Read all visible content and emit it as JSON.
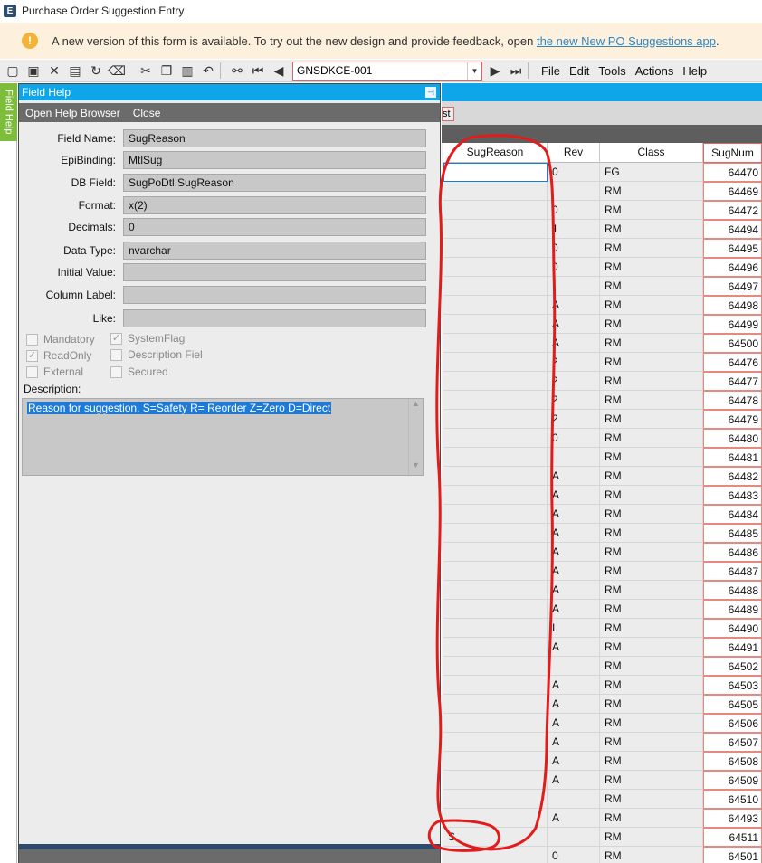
{
  "window": {
    "title": "Purchase Order Suggestion Entry"
  },
  "banner": {
    "text": "A new version of this form is available. To try out the new design and provide feedback, open ",
    "link": "the new New PO Suggestions app",
    "suffix": "."
  },
  "toolbar": {
    "combo_value": "GNSDKCE-001",
    "menus": [
      "File",
      "Edit",
      "Tools",
      "Actions",
      "Help"
    ]
  },
  "side_tab": "Field Help",
  "field_help": {
    "title": "Field Help",
    "open_browser": "Open Help Browser",
    "close": "Close",
    "fields": [
      {
        "label": "Field Name:",
        "value": "SugReason"
      },
      {
        "label": "EpiBinding:",
        "value": "MtlSug"
      },
      {
        "label": "DB Field:",
        "value": "SugPoDtl.SugReason"
      },
      {
        "label": "Format:",
        "value": "x(2)"
      },
      {
        "label": "Decimals:",
        "value": "0"
      },
      {
        "label": "Data Type:",
        "value": "nvarchar"
      },
      {
        "label": "Initial Value:",
        "value": ""
      },
      {
        "label": "Column Label:",
        "value": ""
      },
      {
        "label": "Like:",
        "value": ""
      }
    ],
    "checks": {
      "mandatory": "Mandatory",
      "system_flag": "SystemFlag",
      "read_only": "ReadOnly",
      "description_field": "Description Fiel",
      "external": "External",
      "secured": "Secured"
    },
    "description_label": "Description:",
    "description": "Reason for suggestion. S=Safety  R= Reorder Z=Zero D=Direct"
  },
  "right_tab_fragment": "st",
  "grid": {
    "columns": [
      "SugReason",
      "Rev",
      "Class",
      "SugNum"
    ],
    "rows": [
      [
        "",
        "0",
        "FG",
        "64470"
      ],
      [
        "",
        "",
        "RM",
        "64469"
      ],
      [
        "",
        "0",
        "RM",
        "64472"
      ],
      [
        "",
        "1",
        "RM",
        "64494"
      ],
      [
        "",
        "0",
        "RM",
        "64495"
      ],
      [
        "",
        "0",
        "RM",
        "64496"
      ],
      [
        "",
        "",
        "RM",
        "64497"
      ],
      [
        "",
        "A",
        "RM",
        "64498"
      ],
      [
        "",
        "A",
        "RM",
        "64499"
      ],
      [
        "",
        "A",
        "RM",
        "64500"
      ],
      [
        "",
        "2",
        "RM",
        "64476"
      ],
      [
        "",
        "2",
        "RM",
        "64477"
      ],
      [
        "",
        "2",
        "RM",
        "64478"
      ],
      [
        "",
        "2",
        "RM",
        "64479"
      ],
      [
        "",
        "0",
        "RM",
        "64480"
      ],
      [
        "",
        "",
        "RM",
        "64481"
      ],
      [
        "",
        "A",
        "RM",
        "64482"
      ],
      [
        "",
        "A",
        "RM",
        "64483"
      ],
      [
        "",
        "A",
        "RM",
        "64484"
      ],
      [
        "",
        "A",
        "RM",
        "64485"
      ],
      [
        "",
        "A",
        "RM",
        "64486"
      ],
      [
        "",
        "A",
        "RM",
        "64487"
      ],
      [
        "",
        "A",
        "RM",
        "64488"
      ],
      [
        "",
        "A",
        "RM",
        "64489"
      ],
      [
        "",
        "I",
        "RM",
        "64490"
      ],
      [
        "",
        "A",
        "RM",
        "64491"
      ],
      [
        "",
        "",
        "RM",
        "64502"
      ],
      [
        "",
        "A",
        "RM",
        "64503"
      ],
      [
        "",
        "A",
        "RM",
        "64505"
      ],
      [
        "",
        "A",
        "RM",
        "64506"
      ],
      [
        "",
        "A",
        "RM",
        "64507"
      ],
      [
        "",
        "A",
        "RM",
        "64508"
      ],
      [
        "",
        "A",
        "RM",
        "64509"
      ],
      [
        "",
        "",
        "RM",
        "64510"
      ],
      [
        "",
        "A",
        "RM",
        "64493"
      ],
      [
        "S",
        "",
        "RM",
        "64511"
      ],
      [
        "",
        "0",
        "RM",
        "64501"
      ]
    ]
  },
  "colors": {
    "accent": "#0ea5e9",
    "annotation": "#e31b1b",
    "sidetab": "#7dbd3b"
  }
}
